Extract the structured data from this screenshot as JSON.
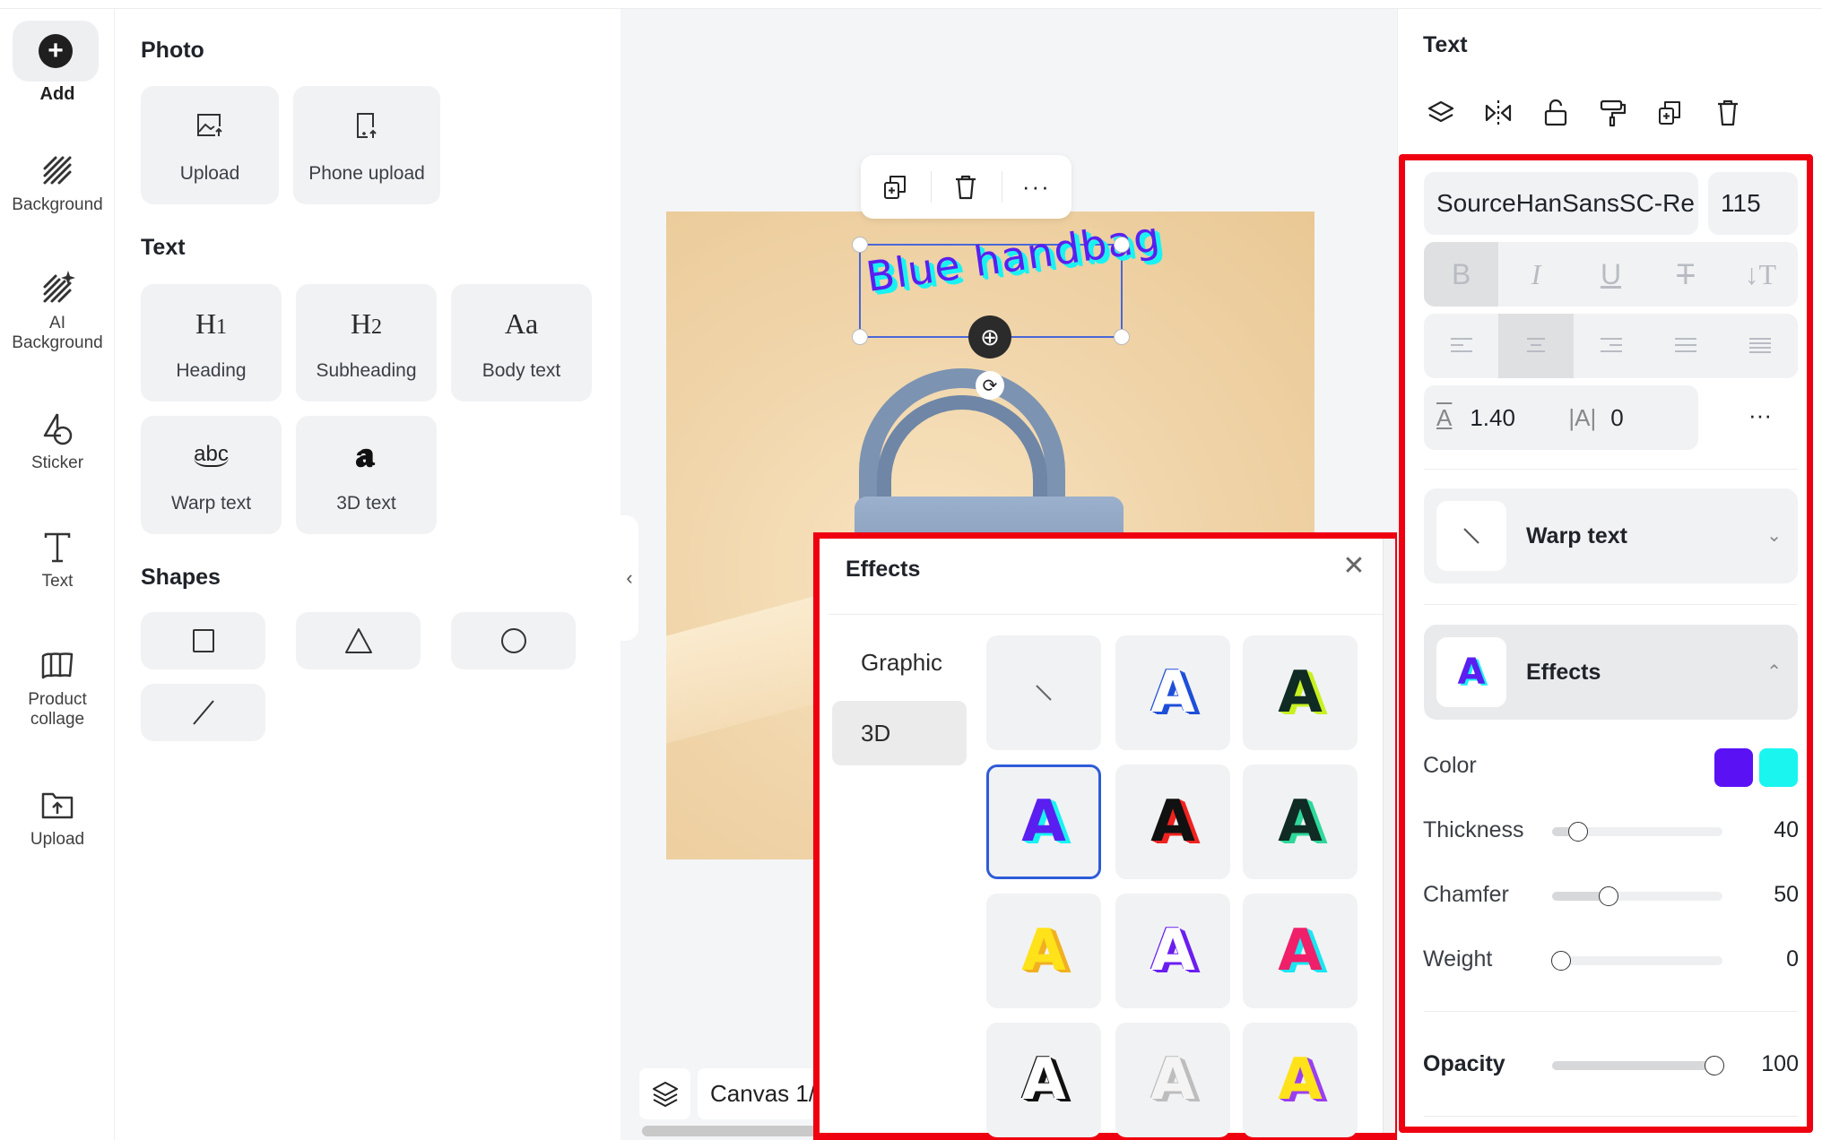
{
  "rail": {
    "add_label": "Add",
    "items": [
      {
        "label": "Background",
        "icon": "background-stripes-icon"
      },
      {
        "label": "AI\nBackground",
        "label_line1": "AI",
        "label_line2": "Background",
        "icon": "ai-background-icon"
      },
      {
        "label": "Sticker",
        "icon": "sticker-icon"
      },
      {
        "label": "Text",
        "icon": "text-icon"
      },
      {
        "label": "Product collage",
        "label_line1": "Product",
        "label_line2": "collage",
        "icon": "product-collage-icon"
      },
      {
        "label": "Upload",
        "icon": "upload-folder-icon"
      }
    ]
  },
  "left_panel": {
    "photo_title": "Photo",
    "photo_cards": [
      {
        "label": "Upload",
        "icon": "image-upload-icon"
      },
      {
        "label": "Phone upload",
        "icon": "phone-upload-icon"
      }
    ],
    "text_title": "Text",
    "text_cards": [
      {
        "label": "Heading",
        "glyph": "H1"
      },
      {
        "label": "Subheading",
        "glyph": "H2"
      },
      {
        "label": "Body text",
        "glyph": "Aa"
      },
      {
        "label": "Warp text",
        "glyph": "abc"
      },
      {
        "label": "3D text",
        "glyph": "a"
      }
    ],
    "shapes_title": "Shapes",
    "shapes": [
      "square",
      "triangle",
      "circle",
      "line"
    ],
    "collapse_icon": "chevron-left-icon"
  },
  "canvas": {
    "text_content": "Blue handbag",
    "text_colors": {
      "face": "#5a1ff0",
      "extrude": "#19f2f2"
    },
    "toolbar": [
      "duplicate",
      "delete",
      "more"
    ],
    "canvas_label": "Canvas 1/"
  },
  "effects_popup": {
    "title": "Effects",
    "tabs": [
      {
        "label": "Graphic",
        "active": false
      },
      {
        "label": "3D",
        "active": true
      }
    ],
    "presets": [
      {
        "name": "none",
        "face": "",
        "side": ""
      },
      {
        "name": "white-blue",
        "face": "#ffffff",
        "side": "#1f4fd8"
      },
      {
        "name": "dark-lime",
        "face": "#0f2b24",
        "side": "#c8f020"
      },
      {
        "name": "purple-cyan",
        "face": "#5a1ff0",
        "side": "#19f2f2",
        "selected": true
      },
      {
        "name": "black-red",
        "face": "#111111",
        "side": "#f0221f"
      },
      {
        "name": "dark-green",
        "face": "#0f2b24",
        "side": "#2ed89a"
      },
      {
        "name": "yellow-orange",
        "face": "#ffe21a",
        "side": "#f0b020"
      },
      {
        "name": "white-purple",
        "face": "#ffffff",
        "side": "#6a1ff0"
      },
      {
        "name": "pink-cyan",
        "face": "#f01f6a",
        "side": "#19e6f2"
      },
      {
        "name": "white-black",
        "face": "#ffffff",
        "side": "#111111"
      },
      {
        "name": "white-gray",
        "face": "#f4f4f4",
        "side": "#bdbdbd"
      },
      {
        "name": "yellow-purple",
        "face": "#ffe21a",
        "side": "#9a3ff0"
      }
    ]
  },
  "right_panel": {
    "title": "Text",
    "tool_icons": [
      "layers-icon",
      "flip-icon",
      "unlock-icon",
      "format-painter-icon",
      "duplicate-icon",
      "delete-icon"
    ],
    "font_name": "SourceHanSansSC-Re",
    "font_size": "115",
    "style_buttons": [
      {
        "glyph": "B",
        "name": "bold",
        "active": true
      },
      {
        "glyph": "I",
        "name": "italic",
        "active": false
      },
      {
        "glyph": "U",
        "name": "underline",
        "active": false
      },
      {
        "glyph": "T",
        "name": "strikethrough",
        "active": false
      },
      {
        "glyph": "↓T",
        "name": "vertical-text",
        "active": false
      }
    ],
    "align_buttons": [
      {
        "name": "align-left",
        "active": false
      },
      {
        "name": "align-center",
        "active": true
      },
      {
        "name": "align-right",
        "active": false
      },
      {
        "name": "justify",
        "active": false
      },
      {
        "name": "justify-all",
        "active": false
      }
    ],
    "line_height": "1.40",
    "letter_spacing": "0",
    "more": "···",
    "warp_label": "Warp text",
    "effects_label": "Effects",
    "color_label": "Color",
    "colors": [
      "#5a12f5",
      "#1af5f0"
    ],
    "thickness": {
      "label": "Thickness",
      "value": "40",
      "fraction": 0.15
    },
    "chamfer": {
      "label": "Chamfer",
      "value": "50",
      "fraction": 0.33
    },
    "weight": {
      "label": "Weight",
      "value": "0",
      "fraction": 0.05
    },
    "opacity": {
      "label": "Opacity",
      "value": "100",
      "fraction": 0.95
    }
  }
}
